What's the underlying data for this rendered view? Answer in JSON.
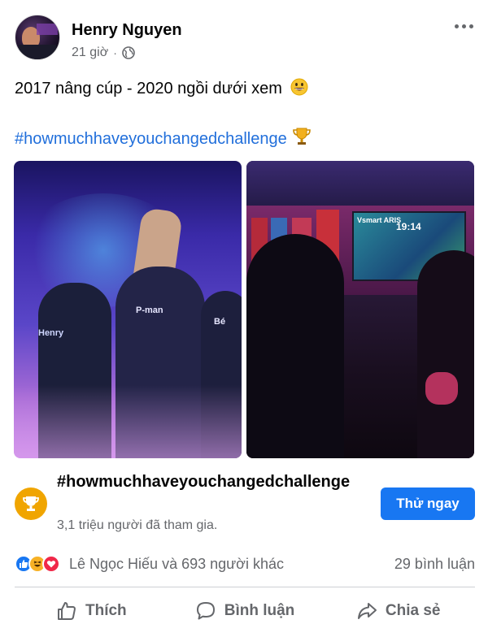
{
  "post": {
    "author": "Henry Nguyen",
    "time": "21 giờ",
    "separator": "·",
    "text": "2017 nâng cúp - 2020 ngồi dưới xem",
    "hashtag": "#howmuchhaveyouchangedchallenge"
  },
  "photos": {
    "left_labels": {
      "henry": "Henry",
      "pman": "P-man",
      "be": "Bé"
    },
    "right_screen": {
      "brand": "Vsmart ARIS",
      "time": "19:14"
    }
  },
  "challenge": {
    "title": "#howmuchhaveyouchangedchallenge",
    "participants": "3,1 triệu người đã tham gia.",
    "button_label": "Thử ngay"
  },
  "stats": {
    "reactions_text": "Lê Ngọc Hiếu và 693 người khác",
    "comments_text": "29 bình luận"
  },
  "actions": {
    "like": "Thích",
    "comment": "Bình luận",
    "share": "Chia sẻ"
  },
  "colors": {
    "link": "#216fdb",
    "button": "#1877f2",
    "muted": "#65676b",
    "trophy": "#f0a500"
  },
  "icons": [
    "globe-icon",
    "more-icon",
    "grinning-emoji-icon",
    "trophy-icon",
    "like-reaction-icon",
    "haha-reaction-icon",
    "love-reaction-icon",
    "like-icon",
    "comment-icon",
    "share-icon"
  ]
}
